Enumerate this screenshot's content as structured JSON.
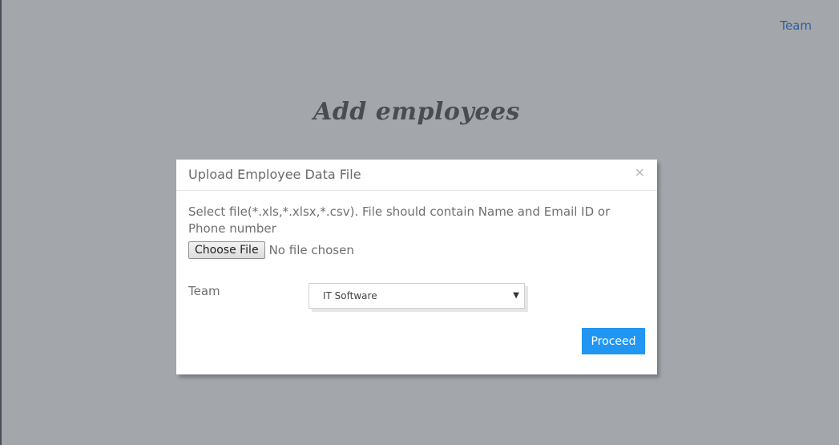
{
  "header": {
    "team_link": "Team",
    "page_title": "Add employees"
  },
  "modal": {
    "title": "Upload Employee Data File",
    "close_glyph": "×",
    "instructions": "Select file(*.xls,*.xlsx,*.csv). File should contain Name and Email ID or Phone number",
    "file_input": {
      "button_label": "Choose File",
      "status": "No file chosen"
    },
    "team": {
      "label": "Team",
      "selected": "IT Software",
      "arrow_glyph": "▼"
    },
    "proceed_label": "Proceed"
  },
  "colors": {
    "overlay": "#a3a6aa",
    "link": "#2e5f9e",
    "primary_button": "#2196f3"
  }
}
